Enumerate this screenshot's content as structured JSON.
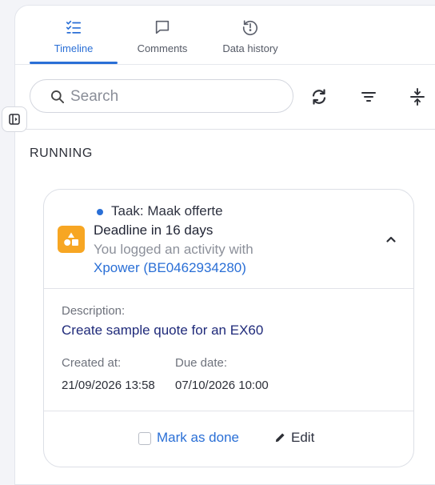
{
  "tabs": [
    {
      "label": "Timeline",
      "icon": "checklist-icon",
      "active": true
    },
    {
      "label": "Comments",
      "icon": "comment-icon",
      "active": false
    },
    {
      "label": "Data history",
      "icon": "history-icon",
      "active": false
    }
  ],
  "toolbar": {
    "search_placeholder": "Search",
    "search_value": "",
    "buttons": [
      "refresh-icon",
      "filter-icon",
      "expand-vertical-icon"
    ]
  },
  "section": {
    "title": "RUNNING"
  },
  "card": {
    "task_title": "Taak: Maak offerte",
    "deadline": "Deadline in 16 days",
    "logged_text": "You logged an activity with",
    "company_link": "Xpower (BE0462934280)",
    "description_label": "Description:",
    "description_value": "Create sample quote for an EX60",
    "created_label": "Created at:",
    "created_value": "21/09/2026 13:58",
    "due_label": "Due date:",
    "due_value": "07/10/2026 10:00",
    "mark_done_label": "Mark as done",
    "edit_label": "Edit"
  },
  "colors": {
    "accent": "#2a6fd6",
    "task_icon_bg": "#f7a623"
  }
}
